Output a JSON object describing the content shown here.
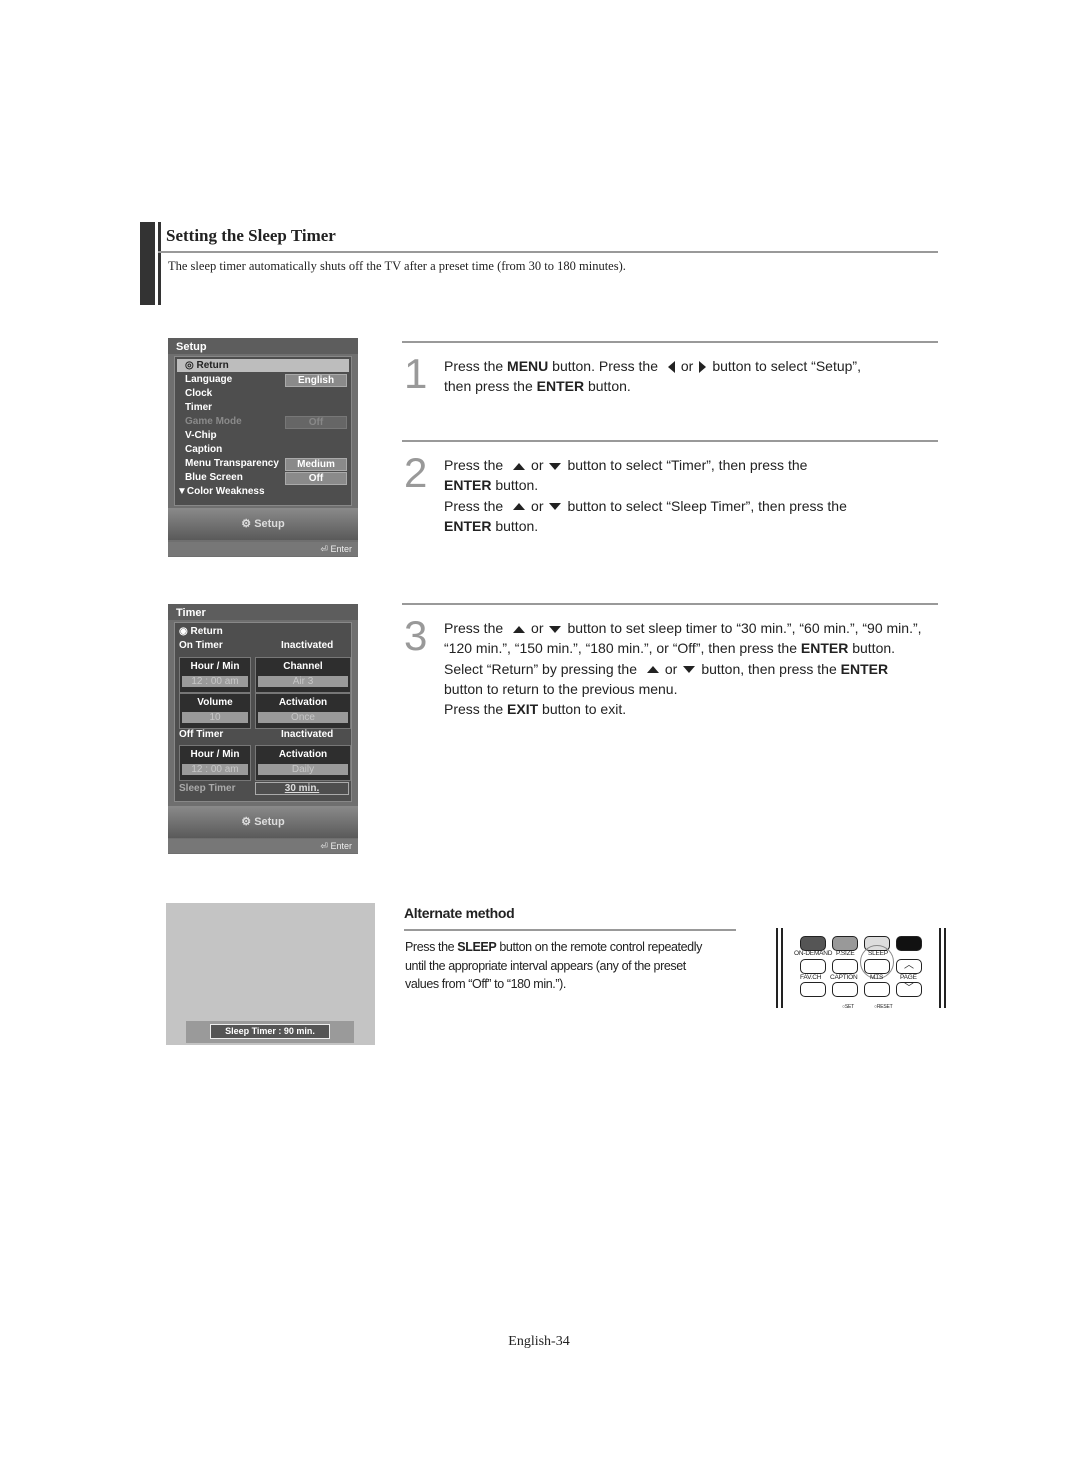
{
  "header": {
    "title": "Setting the Sleep Timer",
    "description": "The sleep timer automatically shuts off the TV after a preset time (from 30 to 180 minutes)."
  },
  "setup_menu": {
    "title": "Setup",
    "items": [
      {
        "label": "Return"
      },
      {
        "label": "Language",
        "value": "English"
      },
      {
        "label": "Clock"
      },
      {
        "label": "Timer"
      },
      {
        "label": "Game Mode",
        "value": "Off"
      },
      {
        "label": "V-Chip"
      },
      {
        "label": "Caption"
      },
      {
        "label": "Menu Transparency",
        "value": "Medium"
      },
      {
        "label": "Blue Screen",
        "value": "Off"
      },
      {
        "label": "Color Weakness"
      }
    ],
    "footer_label": "Setup",
    "enter_label": "Enter"
  },
  "timer_menu": {
    "title": "Timer",
    "return_label": "Return",
    "on_timer": {
      "label": "On Timer",
      "status": "Inactivated",
      "hour_min_label": "Hour / Min",
      "hour_min_value": "12  :  00    am",
      "channel_label": "Channel",
      "channel_value": "Air            3",
      "volume_label": "Volume",
      "volume_value": "10",
      "activation_label": "Activation",
      "activation_value": "Once"
    },
    "off_timer": {
      "label": "Off Timer",
      "status": "Inactivated",
      "hour_min_label": "Hour / Min",
      "hour_min_value": "12  :  00    am",
      "activation_label": "Activation",
      "activation_value": "Daily"
    },
    "sleep_timer": {
      "label": "Sleep Timer",
      "value": "30 min."
    },
    "footer_label": "Setup",
    "enter_label": "Enter"
  },
  "steps": [
    {
      "number": "1",
      "lines": [
        "Press the ",
        "MENU",
        " button. Press the ",
        "or",
        "button to select “Setup”,",
        "then press the ",
        "ENTER",
        " button."
      ]
    },
    {
      "number": "2",
      "lines": [
        "Press the ",
        "or",
        "button to select “Timer”, then press the",
        "ENTER",
        " button.",
        "Press the ",
        "or",
        "button to select “Sleep Timer”, then press the",
        "ENTER",
        " button."
      ]
    },
    {
      "number": "3",
      "lines": [
        "Press the ",
        "or",
        "button to set sleep timer to “30 min.”, “60 min.”, “90 min.”,",
        "“120 min.”, “150 min.”, “180 min.”, or “Off”, then press the ",
        "ENTER",
        " button.",
        "Select “Return” by pressing the ",
        "or",
        "button, then press the ",
        "ENTER",
        "button to return to the previous menu.",
        "Press the ",
        "EXIT",
        " button to exit."
      ]
    }
  ],
  "alternate": {
    "title": "Alternate method",
    "text_a": "Press the ",
    "sleep": "SLEEP",
    "text_b": " button on the remote control repeatedly",
    "line2": "until the appropriate interval appears (any of the preset",
    "line3": "values from “Off” to “180 min.”).",
    "osd_label": "Sleep Timer : 90 min."
  },
  "remote": {
    "labels": [
      "ON-DEMAND",
      "P.SIZE",
      "SLEEP",
      "FAV.CH",
      "CAPTION",
      "MTS",
      "PAGE",
      "SET",
      "RESET"
    ]
  },
  "footer": {
    "page": "English-34"
  }
}
